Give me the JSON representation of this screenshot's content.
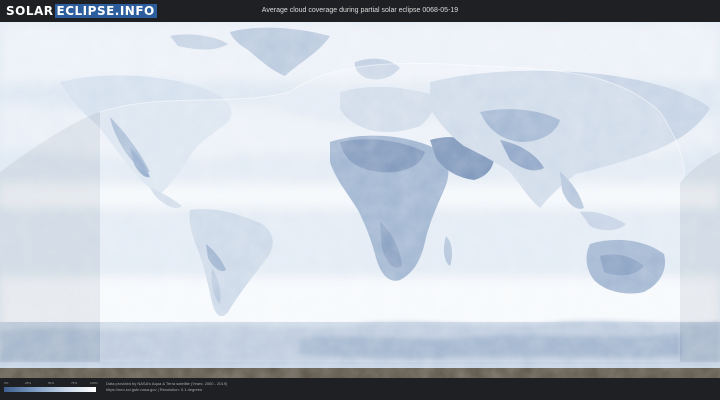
{
  "header": {
    "logo_left": "SOLAR",
    "logo_right": "ECLIPSE.INFO",
    "title": "Average cloud coverage during partial solar eclipse 0068-05-19"
  },
  "legend": {
    "ticks": [
      "0%",
      "25%",
      "50%",
      "75%",
      "100%"
    ],
    "colors": [
      "#3e5f8e",
      "#7e9cc2",
      "#c7d6e8",
      "#ffffff"
    ]
  },
  "footer": {
    "credit_line1": "Data provided by NASA's Aqua & Terra satellite (Years: 2000 - 2019)",
    "credit_line2": "https://neo.sci.gsfc.nasa.gov | Resolution: 0.1 degrees"
  },
  "map": {
    "ocean_color": "#e2ebf5",
    "cloudy_color": "#f2f6fb",
    "clear_color": "#5e7fab",
    "eclipse_overlay_color": "#ffffff"
  }
}
